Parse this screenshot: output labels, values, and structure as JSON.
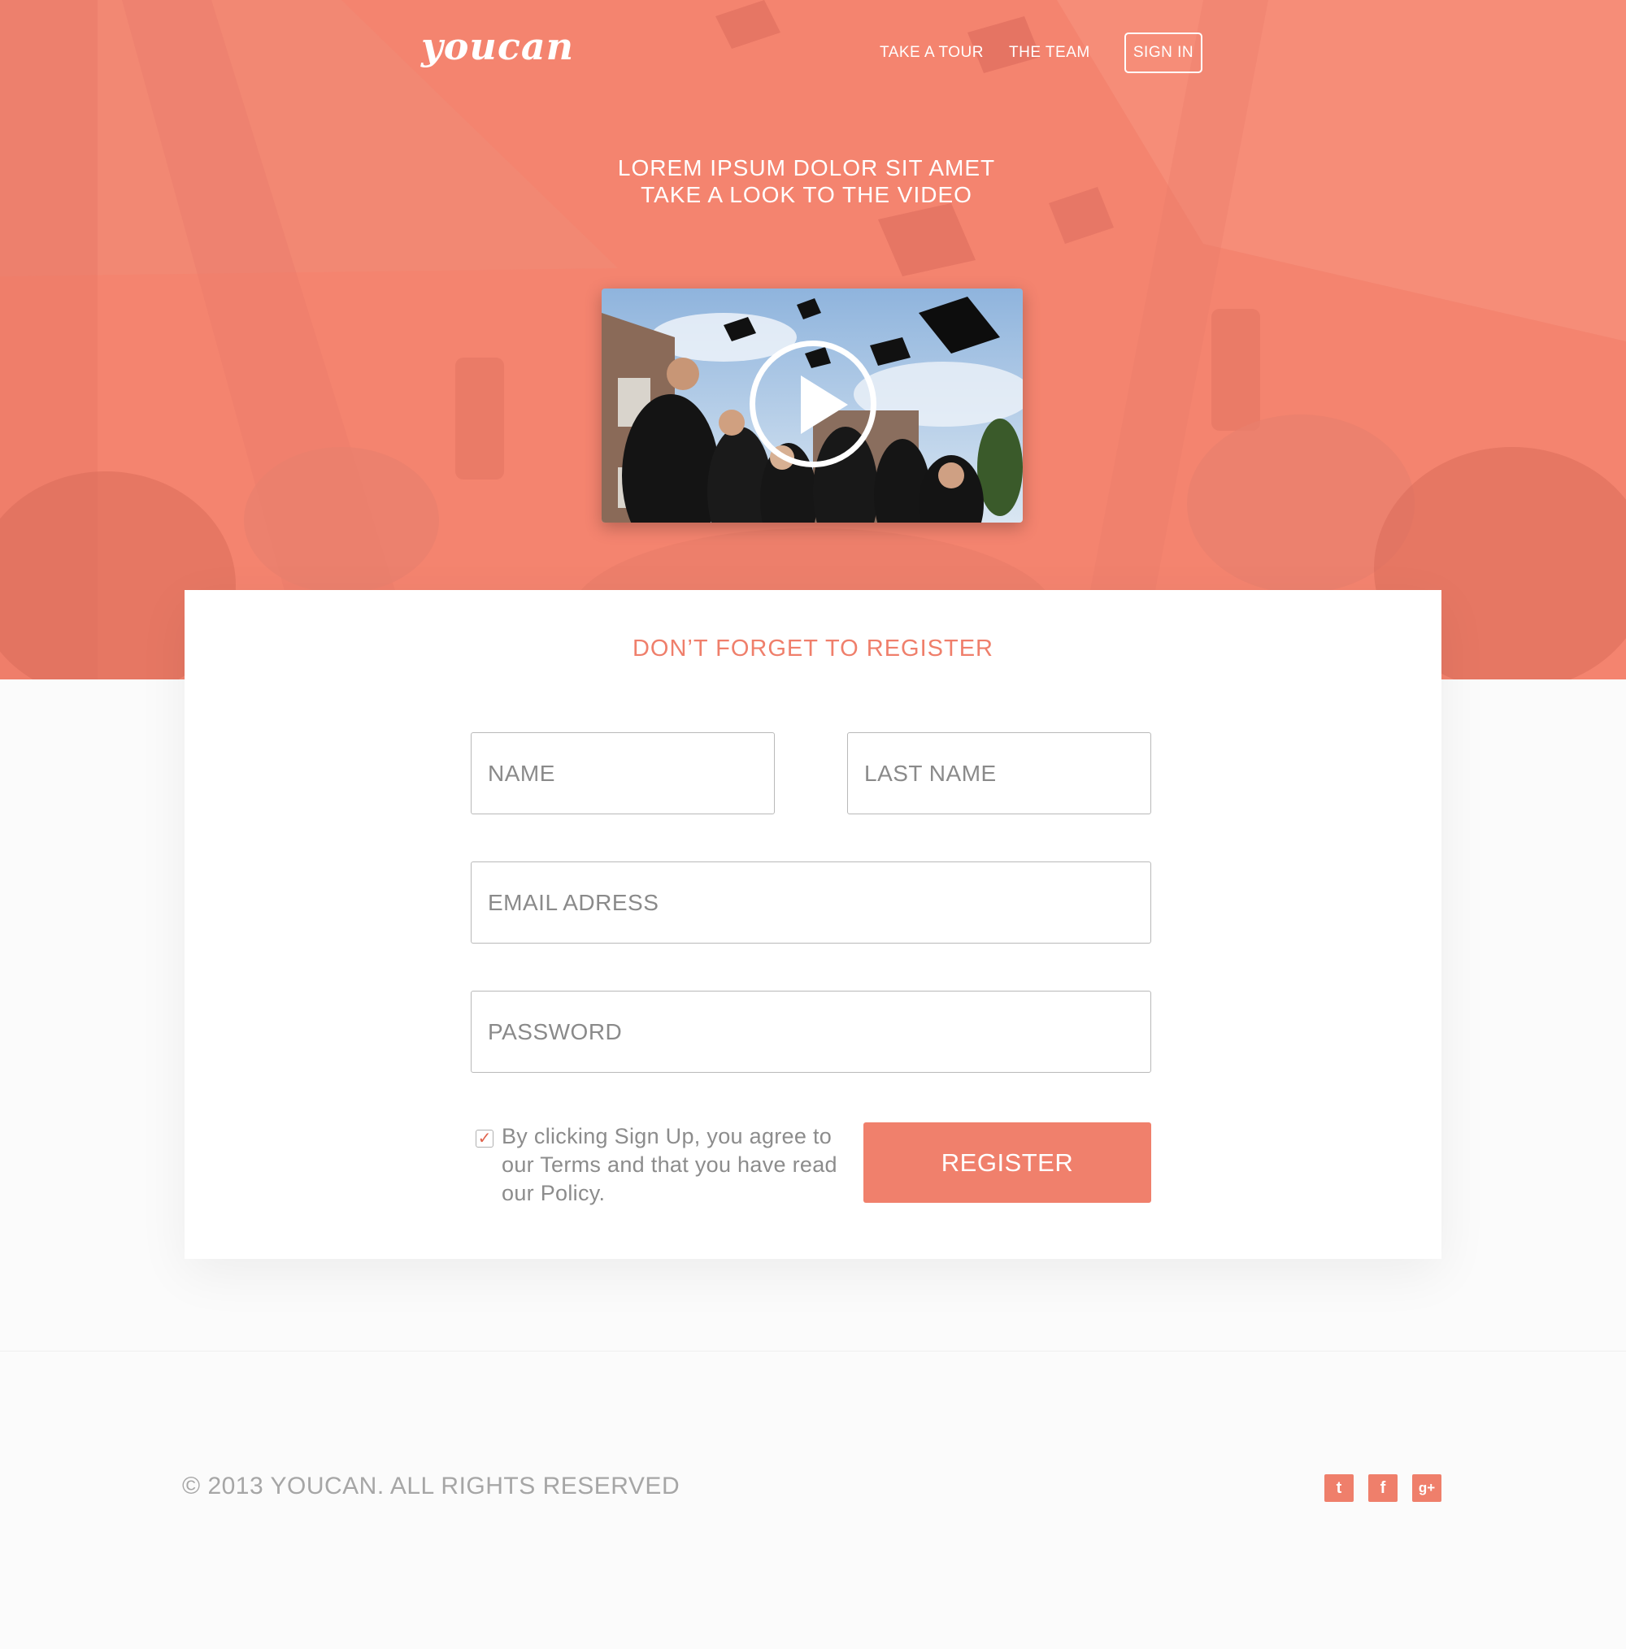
{
  "brand": {
    "logo": "youcan",
    "accent": "#ef7f6b"
  },
  "nav": {
    "links": [
      "TAKE A TOUR",
      "THE TEAM"
    ],
    "signin": "SIGN IN"
  },
  "hero": {
    "line1": "LOREM IPSUM DOLOR SIT AMET",
    "line2": "TAKE A LOOK TO THE VIDEO",
    "video_icon": "play-icon"
  },
  "form": {
    "title": "DON’T FORGET TO REGISTER",
    "name_placeholder": "NAME",
    "lastname_placeholder": "LAST NAME",
    "email_placeholder": "EMAIL ADRESS",
    "password_placeholder": "PASSWORD",
    "checkbox_checked": true,
    "terms": "By clicking Sign Up, you agree to our Terms and that you have read our Policy.",
    "register": "REGISTER"
  },
  "footer": {
    "copyright": "© 2013 YOUCAN. ALL RIGHTS RESERVED",
    "social": [
      {
        "icon": "twitter-icon",
        "glyph": "t"
      },
      {
        "icon": "facebook-icon",
        "glyph": "f"
      },
      {
        "icon": "google-plus-icon",
        "glyph": "g+"
      }
    ]
  }
}
